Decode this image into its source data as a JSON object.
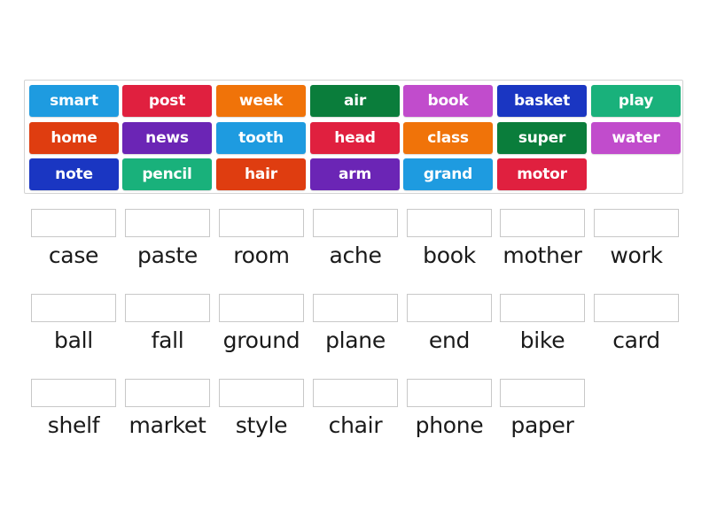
{
  "word_bank": {
    "tiles": [
      {
        "label": "smart",
        "color": "#1e9be0"
      },
      {
        "label": "post",
        "color": "#e0203f"
      },
      {
        "label": "week",
        "color": "#f07309"
      },
      {
        "label": "air",
        "color": "#0a7d3b"
      },
      {
        "label": "book",
        "color": "#c14ccc"
      },
      {
        "label": "basket",
        "color": "#1a36c2"
      },
      {
        "label": "play",
        "color": "#19b17b"
      },
      {
        "label": "home",
        "color": "#df3d10"
      },
      {
        "label": "news",
        "color": "#6b25b5"
      },
      {
        "label": "tooth",
        "color": "#1e9be0"
      },
      {
        "label": "head",
        "color": "#e0203f"
      },
      {
        "label": "class",
        "color": "#f07309"
      },
      {
        "label": "super",
        "color": "#0a7d3b"
      },
      {
        "label": "water",
        "color": "#c14ccc"
      },
      {
        "label": "note",
        "color": "#1a36c2"
      },
      {
        "label": "pencil",
        "color": "#19b17b"
      },
      {
        "label": "hair",
        "color": "#df3d10"
      },
      {
        "label": "arm",
        "color": "#6b25b5"
      },
      {
        "label": "grand",
        "color": "#1e9be0"
      },
      {
        "label": "motor",
        "color": "#e0203f"
      }
    ]
  },
  "targets": [
    {
      "label": "case",
      "value": ""
    },
    {
      "label": "paste",
      "value": ""
    },
    {
      "label": "room",
      "value": ""
    },
    {
      "label": "ache",
      "value": ""
    },
    {
      "label": "book",
      "value": ""
    },
    {
      "label": "mother",
      "value": ""
    },
    {
      "label": "work",
      "value": ""
    },
    {
      "label": "ball",
      "value": ""
    },
    {
      "label": "fall",
      "value": ""
    },
    {
      "label": "ground",
      "value": ""
    },
    {
      "label": "plane",
      "value": ""
    },
    {
      "label": "end",
      "value": ""
    },
    {
      "label": "bike",
      "value": ""
    },
    {
      "label": "card",
      "value": ""
    },
    {
      "label": "shelf",
      "value": ""
    },
    {
      "label": "market",
      "value": ""
    },
    {
      "label": "style",
      "value": ""
    },
    {
      "label": "chair",
      "value": ""
    },
    {
      "label": "phone",
      "value": ""
    },
    {
      "label": "paper",
      "value": ""
    }
  ]
}
